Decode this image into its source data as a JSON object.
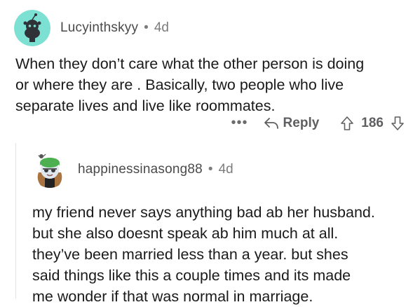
{
  "comments": [
    {
      "username": "Lucyinthskyy",
      "separator": "•",
      "age": "4d",
      "lines": [
        "When they don’t care what the other person is doing",
        "or where they are . Basically, two people who live",
        "separate lives and live like roommates."
      ],
      "actions": {
        "more_label": "•••",
        "reply_label": "Reply",
        "vote_count": "186"
      },
      "avatar_icon": "snoo-avatar-icon",
      "accent": "#7ce0d3"
    },
    {
      "username": "happinessinasong88",
      "separator": "•",
      "age": "4d",
      "lines": [
        "my friend never says anything bad ab her husband.",
        "but she also doesnt speak ab him much at all.",
        "they’ve been married less than a year. but shes",
        "said things like this a couple times and its made",
        "me wonder if that was normal in marriage."
      ],
      "avatar_icon": "custom-avatar-icon",
      "accent": "#4caf50"
    }
  ]
}
